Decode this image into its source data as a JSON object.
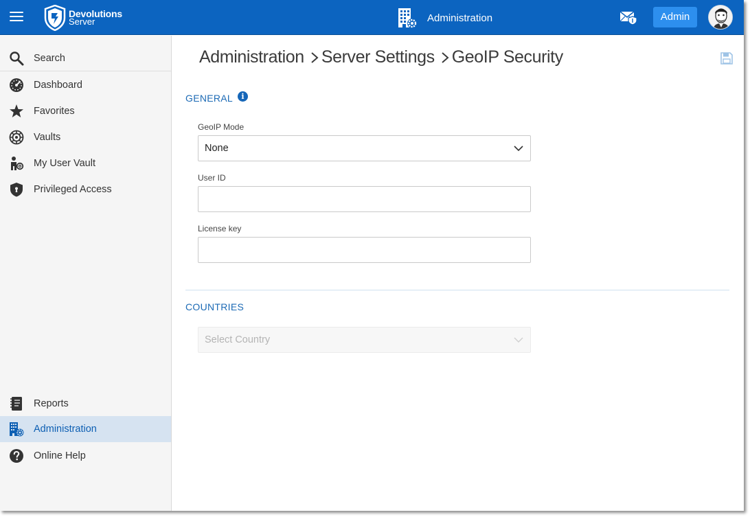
{
  "header": {
    "brand": "Devolutions",
    "product": "Server",
    "section_title": "Administration",
    "admin_button": "Admin"
  },
  "sidebar": {
    "items": [
      {
        "label": "Search",
        "icon": "search-icon"
      },
      {
        "label": "Dashboard",
        "icon": "dashboard-icon"
      },
      {
        "label": "Favorites",
        "icon": "star-icon"
      },
      {
        "label": "Vaults",
        "icon": "vault-icon"
      },
      {
        "label": "My User Vault",
        "icon": "user-vault-icon"
      },
      {
        "label": "Privileged Access",
        "icon": "shield-icon"
      }
    ],
    "bottom_items": [
      {
        "label": "Reports",
        "icon": "reports-icon"
      },
      {
        "label": "Administration",
        "icon": "administration-icon",
        "active": true
      },
      {
        "label": "Online Help",
        "icon": "help-icon"
      }
    ]
  },
  "breadcrumb": [
    "Administration",
    "Server Settings",
    "GeoIP Security"
  ],
  "general": {
    "title": "GENERAL",
    "geoip_mode_label": "GeoIP Mode",
    "geoip_mode_value": "None",
    "user_id_label": "User ID",
    "user_id_value": "",
    "license_key_label": "License key",
    "license_key_value": ""
  },
  "countries": {
    "title": "COUNTRIES",
    "select_placeholder": "Select Country"
  },
  "colors": {
    "header_bg": "#0c64c0",
    "admin_button_bg": "#2d8fee",
    "accent": "#1c6ab5",
    "active_nav_bg": "#d6e3f1"
  }
}
